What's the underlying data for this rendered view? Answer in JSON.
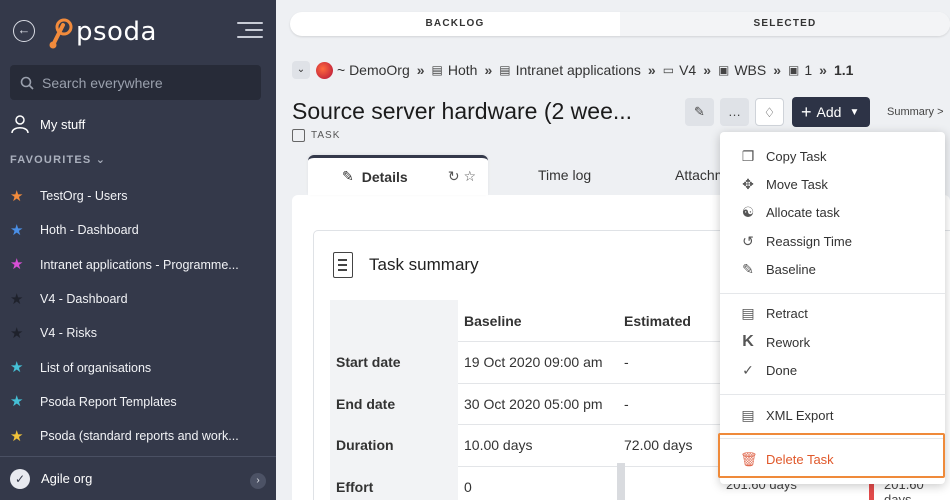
{
  "sidebar": {
    "logo_text": "psoda",
    "search_placeholder": "Search everywhere",
    "my_stuff": "My stuff",
    "favourites_title": "FAVOURITES",
    "favourites": [
      {
        "label": "TestOrg - Users",
        "color": "#f28b3c"
      },
      {
        "label": "Hoth - Dashboard",
        "color": "#4a8fe6"
      },
      {
        "label": "Intranet applications - Programme...",
        "color": "#d84fd6"
      },
      {
        "label": "V4 - Dashboard",
        "color": "#2b2f3b"
      },
      {
        "label": "V4 - Risks",
        "color": "#2b2f3b"
      },
      {
        "label": "List of organisations",
        "color": "#45c0d6"
      },
      {
        "label": "Psoda Report Templates",
        "color": "#45c0d6"
      },
      {
        "label": "Psoda (standard reports and work...",
        "color": "#f0c23a"
      }
    ],
    "bottom_label": "Agile org"
  },
  "top_tabs": {
    "backlog": "BACKLOG",
    "selected": "SELECTED"
  },
  "breadcrumb": {
    "org": "~ DemoOrg",
    "items": [
      "Hoth",
      "Intranet applications",
      "V4",
      "WBS",
      "1",
      "1.1"
    ]
  },
  "page": {
    "title": "Source server hardware (2 wee...",
    "type_label": "TASK",
    "add_label": "Add",
    "summary_link": "Summary >"
  },
  "tabs": {
    "details": "Details",
    "time_log": "Time log",
    "attach": "Attachm"
  },
  "task_summary": {
    "title": "Task summary",
    "columns": [
      "",
      "Baseline",
      "Estimated"
    ],
    "rows": [
      {
        "label": "Start date",
        "baseline": "19 Oct 2020 09:00 am",
        "estimated": "-"
      },
      {
        "label": "End date",
        "baseline": "30 Oct 2020 05:00 pm",
        "estimated": "-"
      },
      {
        "label": "Duration",
        "baseline": "10.00 days",
        "estimated": "72.00 days"
      },
      {
        "label": "Effort",
        "baseline": "0",
        "estimated": ""
      }
    ],
    "hidden_values": {
      "effort_a": "201.60 days",
      "effort_b": "201.60 days"
    }
  },
  "menu": {
    "group1": [
      {
        "label": "Copy Task",
        "icon": "copy-icon"
      },
      {
        "label": "Move Task",
        "icon": "move-icon"
      },
      {
        "label": "Allocate task",
        "icon": "allocate-icon"
      },
      {
        "label": "Reassign Time",
        "icon": "reassign-icon"
      },
      {
        "label": "Baseline",
        "icon": "baseline-icon"
      }
    ],
    "group2": [
      {
        "label": "Retract",
        "icon": "retract-icon"
      },
      {
        "label": "Rework",
        "icon": "rework-icon"
      },
      {
        "label": "Done",
        "icon": "done-icon"
      }
    ],
    "group3": [
      {
        "label": "XML Export",
        "icon": "xml-icon"
      }
    ],
    "delete": {
      "label": "Delete Task",
      "icon": "trash-icon"
    }
  }
}
